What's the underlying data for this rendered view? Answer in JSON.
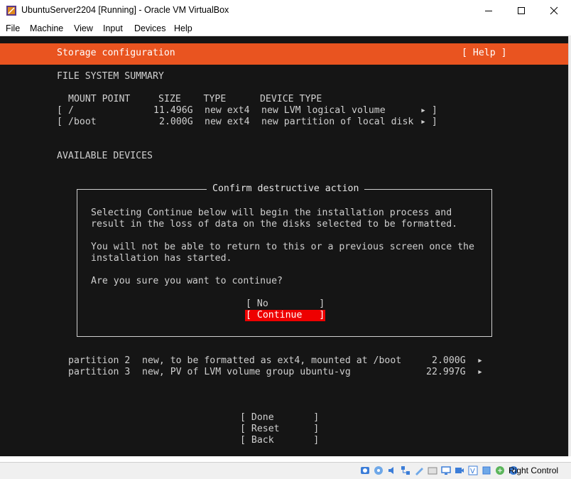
{
  "window": {
    "title": "UbuntuServer2204 [Running] - Oracle VM VirtualBox",
    "controls": [
      "minimize",
      "maximize",
      "close"
    ]
  },
  "menu": {
    "file": "File",
    "machine": "Machine",
    "view": "View",
    "input": "Input",
    "devices": "Devices",
    "help": "Help"
  },
  "installer": {
    "header_title": "Storage configuration",
    "help_button": "[ Help ]",
    "fs_summary_heading": "FILE SYSTEM SUMMARY",
    "fs_columns": "MOUNT POINT     SIZE    TYPE      DEVICE TYPE",
    "fs_rows": [
      {
        "open": "[",
        "mount": "/",
        "size": "11.496G",
        "type": "new ext4",
        "device_type": "new LVM logical volume",
        "arrow": "▸ ]"
      },
      {
        "open": "[",
        "mount": "/boot",
        "size": "2.000G",
        "type": "new ext4",
        "device_type": "new partition of local disk",
        "arrow": "▸ ]"
      }
    ],
    "available_devices_heading": "AVAILABLE DEVICES",
    "partitions": [
      {
        "label": "partition 2",
        "description": "new, to be formatted as ext4, mounted at /boot",
        "size": "2.000G",
        "arrow": "▸"
      },
      {
        "label": "partition 3",
        "description": "new, PV of LVM volume group ubuntu-vg",
        "size": "22.997G",
        "arrow": "▸"
      }
    ],
    "bottom_buttons": {
      "done": "[ Done       ]",
      "reset": "[ Reset      ]",
      "back": "[ Back       ]"
    }
  },
  "dialog": {
    "title": "Confirm destructive action",
    "lines": [
      "Selecting Continue below will begin the installation process and",
      "result in the loss of data on the disks selected to be formatted.",
      "You will not be able to return to this or a previous screen once the",
      "installation has started.",
      "Are you sure you want to continue?"
    ],
    "no_button": "[ No         ]",
    "continue_button": "[ Continue   ]"
  },
  "statusbar": {
    "host_key_label": "Right Control",
    "icons": [
      "hard-disk-icon",
      "optical-drive-icon",
      "audio-icon",
      "network-icon",
      "usb-icon",
      "shared-folders-icon",
      "display-icon",
      "video-capture-icon",
      "recording-icon",
      "cpu-icon",
      "mouse-integration-icon",
      "keyboard-icon"
    ]
  },
  "colors": {
    "header": "#e95420",
    "terminal_bg": "#151515",
    "terminal_text": "#cfcfcf",
    "selected_button": "#ee0000"
  }
}
